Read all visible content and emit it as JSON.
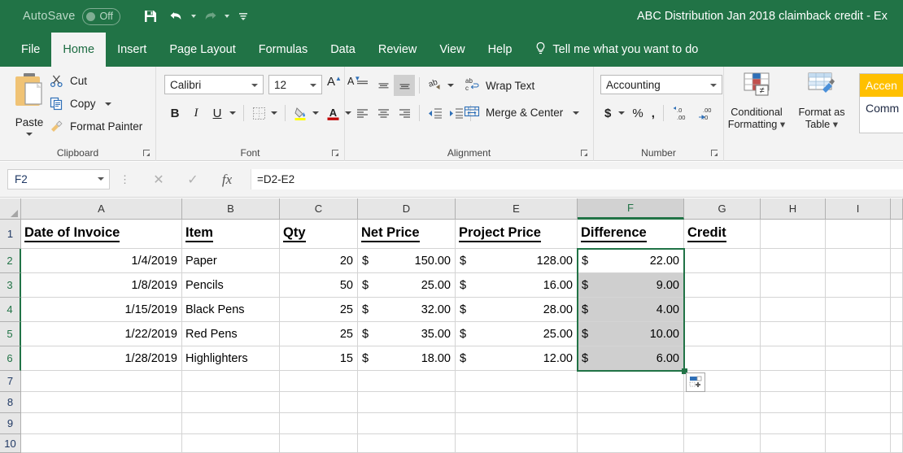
{
  "titlebar": {
    "autosave_label": "AutoSave",
    "autosave_state": "Off",
    "document_title": "ABC Distribution Jan 2018 claimback credit  -  Ex",
    "quick_access": [
      "save-icon",
      "undo-icon",
      "redo-icon",
      "customize-icon"
    ]
  },
  "ribbon_tabs": [
    {
      "label": "File",
      "active": false
    },
    {
      "label": "Home",
      "active": true
    },
    {
      "label": "Insert",
      "active": false
    },
    {
      "label": "Page Layout",
      "active": false
    },
    {
      "label": "Formulas",
      "active": false
    },
    {
      "label": "Data",
      "active": false
    },
    {
      "label": "Review",
      "active": false
    },
    {
      "label": "View",
      "active": false
    },
    {
      "label": "Help",
      "active": false
    }
  ],
  "tell_me": "Tell me what you want to do",
  "groups": {
    "clipboard": {
      "label": "Clipboard",
      "paste": "Paste",
      "cut": "Cut",
      "copy": "Copy",
      "format_painter": "Format Painter"
    },
    "font": {
      "label": "Font",
      "font_name": "Calibri",
      "font_size": "12",
      "bold": "B",
      "italic": "I",
      "underline": "U",
      "grow_font": "A",
      "shrink_font": "A",
      "font_color_hex": "#c00000",
      "fill_color_hex": "#ffff00"
    },
    "alignment": {
      "label": "Alignment",
      "wrap_text": "Wrap Text",
      "merge_center": "Merge & Center"
    },
    "number": {
      "label": "Number",
      "format": "Accounting",
      "currency": "$",
      "percent": "%",
      "comma": ","
    },
    "styles": {
      "conditional_formatting": "Conditional\nFormatting",
      "conditional_formatting_l1": "Conditional",
      "conditional_formatting_l2": "Formatting",
      "format_as_table_l1": "Format as",
      "format_as_table_l2": "Table",
      "gallery": [
        {
          "label": "Accen",
          "style": "accent"
        },
        {
          "label": "Comm",
          "style": "comma"
        }
      ],
      "accent_color_hex": "#ffc000"
    }
  },
  "formula_bar": {
    "name_box": "F2",
    "cancel_icon": "close-icon",
    "enter_icon": "check-icon",
    "function_icon": "fx",
    "formula": "=D2-E2"
  },
  "sheet": {
    "columns": [
      "A",
      "B",
      "C",
      "D",
      "E",
      "F",
      "G",
      "H",
      "I"
    ],
    "selected_column": "F",
    "rows": [
      "1",
      "2",
      "3",
      "4",
      "5",
      "6",
      "7",
      "8",
      "9",
      "10"
    ],
    "selected_rows": [
      "2",
      "3",
      "4",
      "5",
      "6"
    ],
    "active_cell": "F2",
    "selection_range": "F2:F6",
    "headers": {
      "A": "Date of Invoice",
      "B": "Item",
      "C": "Qty",
      "D": "Net Price",
      "E": "Project Price",
      "F": "Difference",
      "G": "Credit"
    },
    "data": [
      {
        "row": "2",
        "date": "1/4/2019",
        "item": "Paper",
        "qty": "20",
        "net_sym": "$",
        "net": "150.00",
        "proj_sym": "$",
        "proj": "128.00",
        "diff_sym": "$",
        "diff": "22.00",
        "credit": ""
      },
      {
        "row": "3",
        "date": "1/8/2019",
        "item": "Pencils",
        "qty": "50",
        "net_sym": "$",
        "net": "25.00",
        "proj_sym": "$",
        "proj": "16.00",
        "diff_sym": "$",
        "diff": "9.00",
        "credit": ""
      },
      {
        "row": "4",
        "date": "1/15/2019",
        "item": "Black Pens",
        "qty": "25",
        "net_sym": "$",
        "net": "32.00",
        "proj_sym": "$",
        "proj": "28.00",
        "diff_sym": "$",
        "diff": "4.00",
        "credit": ""
      },
      {
        "row": "5",
        "date": "1/22/2019",
        "item": "Red Pens",
        "qty": "25",
        "net_sym": "$",
        "net": "35.00",
        "proj_sym": "$",
        "proj": "25.00",
        "diff_sym": "$",
        "diff": "10.00",
        "credit": ""
      },
      {
        "row": "6",
        "date": "1/28/2019",
        "item": "Highlighters",
        "qty": "15",
        "net_sym": "$",
        "net": "18.00",
        "proj_sym": "$",
        "proj": "12.00",
        "diff_sym": "$",
        "diff": "6.00",
        "credit": ""
      }
    ],
    "empty_rows": [
      "7",
      "8",
      "9",
      "10"
    ],
    "autofill_icon": "autofill-options-icon"
  },
  "colors": {
    "excel_green": "#217346",
    "ribbon_bg": "#f3f3f3",
    "selection_green": "#217346",
    "selected_cell_gray": "#cfcfcf"
  }
}
